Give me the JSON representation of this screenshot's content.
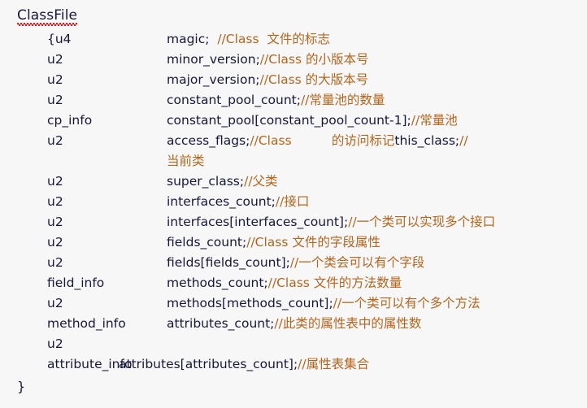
{
  "document": {
    "title": "ClassFile",
    "title_has_spellcheck_underline": true,
    "open_brace": "{",
    "close_brace": "}",
    "colors": {
      "background": "#f7f7f7",
      "code_text": "#17173a",
      "comment_text": "#b5651d",
      "spellcheck_underline": "#e01b1b"
    }
  },
  "rows": [
    {
      "type": "{u4",
      "decl": "magic;  ",
      "comment": "//Class  文件的标志"
    },
    {
      "type": "u2",
      "decl": "minor_version;",
      "comment": "//Class 的小版本号"
    },
    {
      "type": "u2",
      "decl": "major_version;",
      "comment": "//Class 的大版本号"
    },
    {
      "type": "u2",
      "decl": "constant_pool_count;",
      "comment": "//常量池的数量"
    },
    {
      "type": "cp_info",
      "decl": "constant_pool[constant_pool_count-1];",
      "comment": "//常量池"
    },
    {
      "type": "u2",
      "decl": "access_flags;",
      "comment": "//Class          的访问标记",
      "decl2": "this_class;",
      "comment2": "//",
      "wrap": "当前类"
    },
    {
      "type": "u2",
      "decl": "super_class;",
      "comment": "//父类"
    },
    {
      "type": "u2",
      "decl": "interfaces_count;",
      "comment": "//接口"
    },
    {
      "type": "u2",
      "decl": "interfaces[interfaces_count];",
      "comment": "//一个类可以实现多个接口"
    },
    {
      "type": "u2",
      "decl": "fields_count;",
      "comment": "//Class 文件的字段属性"
    },
    {
      "type": "u2",
      "decl": "fields[fields_count];",
      "comment": "//一个类会可以有个字段"
    },
    {
      "type": "field_info",
      "decl": "methods_count;",
      "comment": "//Class 文件的方法数量"
    },
    {
      "type": "u2",
      "decl": "methods[methods_count];",
      "comment": "//一个类可以有个多个方法"
    },
    {
      "type": "method_info",
      "decl": "attributes_count;",
      "comment": "//此类的属性表中的属性数"
    },
    {
      "type": "u2",
      "decl": "",
      "comment": ""
    },
    {
      "type": "attribute_info",
      "decl": "attributes[attributes_count];",
      "comment": "//属性表集合",
      "tight": true
    }
  ]
}
